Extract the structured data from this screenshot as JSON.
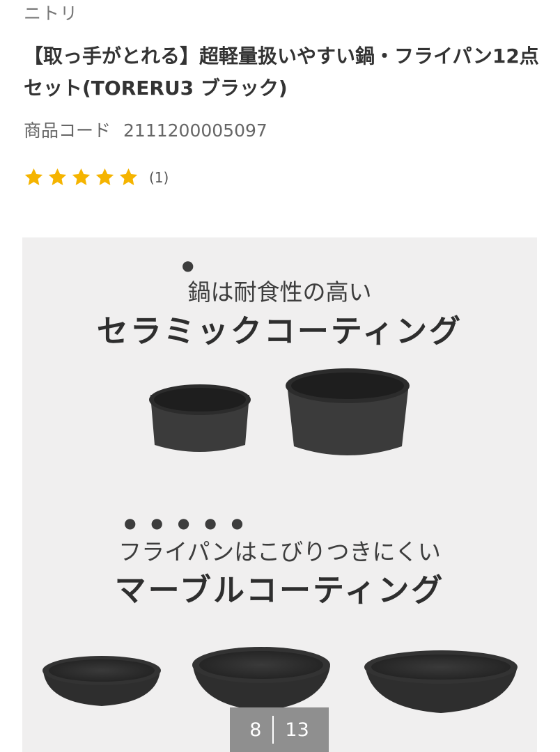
{
  "brand": "ニトリ",
  "product": {
    "title": "【取っ手がとれる】超軽量扱いやすい鍋・フライパン12点セット(TORERU3 ブラック)",
    "code_label": "商品コード",
    "code_value": "2111200005097",
    "rating": {
      "stars": 5,
      "max": 5,
      "review_count": "(1)"
    }
  },
  "image": {
    "line1_small": "鍋は耐食性の高い",
    "line1_large": "セラミックコーティング",
    "line2_small": "フライパンはこびりつきにくい",
    "line2_large": "マーブルコーティング"
  },
  "carousel": {
    "current": "8",
    "total": "13"
  },
  "colors": {
    "star": "#f5b400",
    "panel_bg": "#f0efef",
    "counter_bg": "#8f8f8f"
  }
}
